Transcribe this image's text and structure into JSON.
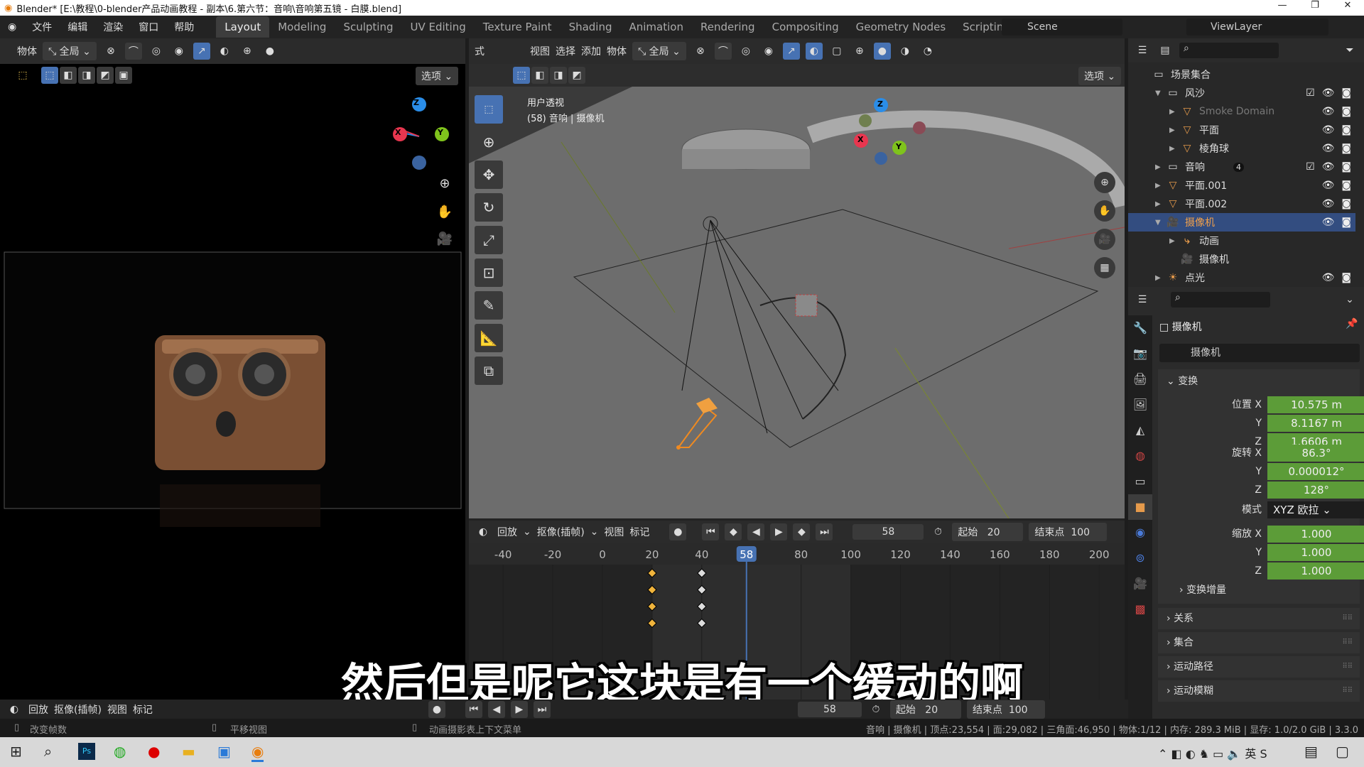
{
  "window": {
    "title": "Blender* [E:\\教程\\0-blender产品动画教程 - 副本\\6.第六节：音响\\音响第五镜 - 白膜.blend]",
    "controls": [
      "—",
      "❐",
      "✕"
    ]
  },
  "menu": [
    "文件",
    "编辑",
    "渲染",
    "窗口",
    "帮助"
  ],
  "workspaces": [
    "Layout",
    "Modeling",
    "Sculpting",
    "UV Editing",
    "Texture Paint",
    "Shading",
    "Animation",
    "Rendering",
    "Compositing",
    "Geometry Nodes",
    "Scripting",
    "+"
  ],
  "active_workspace": "Layout",
  "scene": {
    "name": "Scene",
    "view_layer": "ViewLayer"
  },
  "left_view": {
    "header_menu": "物体",
    "orientation": "全局",
    "options": "选项"
  },
  "viewport": {
    "header_menus": [
      "视图",
      "选择",
      "添加",
      "物体"
    ],
    "orientation": "全局",
    "options": "选项",
    "overlay_title": "用户透视",
    "overlay_sub": "(58) 音响 | 摄像机",
    "mode_suffix": "式"
  },
  "gizmo": {
    "x": "X",
    "y": "Y",
    "z": "Z",
    "colors": {
      "x": "#e8364f",
      "y": "#7fc31c",
      "z": "#2a8de8"
    }
  },
  "timeline": {
    "menus": [
      "回放",
      "抠像(插帧)",
      "视图",
      "标记"
    ],
    "current_frame": "58",
    "start_label": "起始",
    "start": "20",
    "end_label": "结束点",
    "end": "100",
    "ticks": [
      "-40",
      "-20",
      "0",
      "20",
      "40",
      "58",
      "80",
      "100",
      "120",
      "140",
      "160",
      "180",
      "200"
    ],
    "keyframes": {
      "selected_frame": 20,
      "other_frame": 40,
      "rows": 4
    },
    "playhead": 58,
    "accent": "#4772b3"
  },
  "bottom_timeline": {
    "menus": [
      "回放",
      "抠像(插帧)",
      "视图",
      "标记"
    ],
    "current_frame": "58",
    "start_label": "起始",
    "start": "20",
    "end_label": "结束点",
    "end": "100"
  },
  "status": {
    "left1": "改变帧数",
    "left2": "平移视图",
    "left3": "动画摄影表上下文菜单",
    "right": "音响 | 摄像机 | 顶点:23,554 | 面:29,082 | 三角面:46,950 | 物体:1/12 | 内存: 289.3 MiB | 显存: 1.0/2.0 GiB | 3.3.0"
  },
  "outliner": {
    "items": [
      {
        "label": "场景集合",
        "type": "collection",
        "depth": 0
      },
      {
        "label": "风沙",
        "type": "collection",
        "depth": 1
      },
      {
        "label": "Smoke Domain",
        "type": "mesh",
        "depth": 2,
        "dim": true
      },
      {
        "label": "平面",
        "type": "mesh",
        "depth": 2
      },
      {
        "label": "棱角球",
        "type": "mesh",
        "depth": 2
      },
      {
        "label": "音响",
        "type": "collection",
        "depth": 1,
        "badge": "4"
      },
      {
        "label": "平面.001",
        "type": "mesh",
        "depth": 1
      },
      {
        "label": "平面.002",
        "type": "mesh",
        "depth": 1
      },
      {
        "label": "摄像机",
        "type": "camera",
        "depth": 1,
        "selected": true
      },
      {
        "label": "动画",
        "type": "action",
        "depth": 2
      },
      {
        "label": "摄像机",
        "type": "camera-data",
        "depth": 2
      },
      {
        "label": "点光",
        "type": "light",
        "depth": 1
      }
    ]
  },
  "properties": {
    "object_name": "摄像机",
    "datablock": "摄像机",
    "section": "变换",
    "location_label": "位置",
    "rotation_label": "旋转",
    "scale_label": "缩放",
    "mode_label": "模式",
    "location": [
      "10.575 m",
      "8.1167 m",
      "1.6606 m"
    ],
    "rotation": [
      "86.3°",
      "0.000012°",
      "128°"
    ],
    "mode": "XYZ 欧拉",
    "scale": [
      "1.000",
      "1.000",
      "1.000"
    ],
    "axes": [
      "X",
      "Y",
      "Z"
    ],
    "subpanel": "变换增量",
    "panels": [
      "关系",
      "集合",
      "运动路径",
      "运动模糊"
    ],
    "field_color": "#5c9c38"
  },
  "subtitle": "然后但是呢它这块是有一个缓动的啊"
}
